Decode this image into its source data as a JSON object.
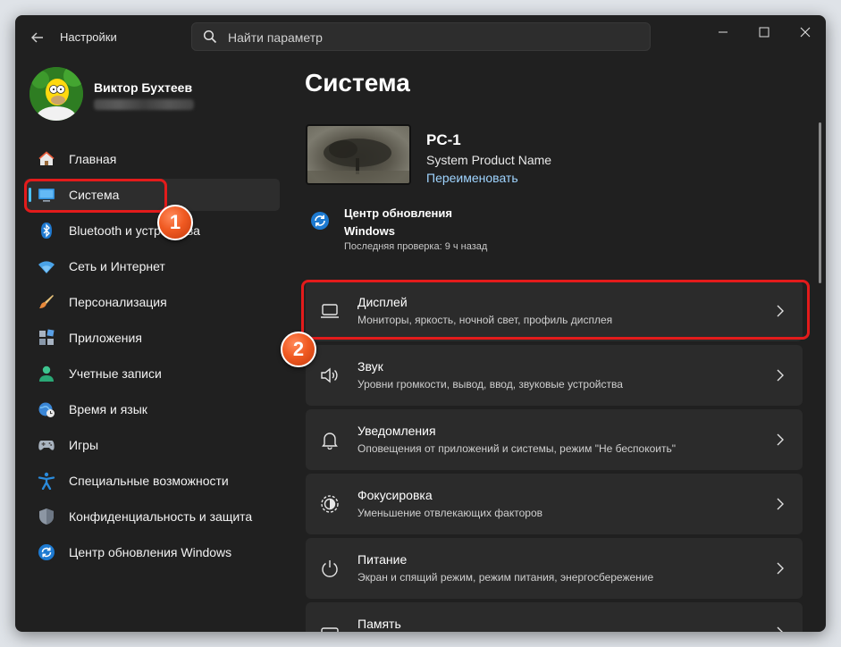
{
  "titlebar": {
    "app_title": "Настройки",
    "search_placeholder": "Найти параметр"
  },
  "profile": {
    "name": "Виктор Бухтеев"
  },
  "sidebar": {
    "items": [
      {
        "label": "Главная",
        "icon": "home-icon"
      },
      {
        "label": "Система",
        "icon": "monitor-icon",
        "active": true
      },
      {
        "label": "Bluetooth и устройства",
        "icon": "bluetooth-icon"
      },
      {
        "label": "Сеть и Интернет",
        "icon": "wifi-icon"
      },
      {
        "label": "Персонализация",
        "icon": "brush-icon"
      },
      {
        "label": "Приложения",
        "icon": "apps-icon"
      },
      {
        "label": "Учетные записи",
        "icon": "person-icon"
      },
      {
        "label": "Время и язык",
        "icon": "globe-clock-icon"
      },
      {
        "label": "Игры",
        "icon": "gamepad-icon"
      },
      {
        "label": "Специальные возможности",
        "icon": "accessibility-icon"
      },
      {
        "label": "Конфиденциальность и защита",
        "icon": "shield-icon"
      },
      {
        "label": "Центр обновления Windows",
        "icon": "update-icon"
      }
    ]
  },
  "main": {
    "title": "Система",
    "device": {
      "name": "PC-1",
      "model": "System Product Name",
      "rename_link": "Переименовать"
    },
    "windows_update": {
      "title": "Центр обновления Windows",
      "status": "Последняя проверка: 9 ч назад"
    },
    "cards": [
      {
        "title": "Дисплей",
        "subtitle": "Мониторы, яркость, ночной свет, профиль дисплея",
        "icon": "display-icon"
      },
      {
        "title": "Звук",
        "subtitle": "Уровни громкости, вывод, ввод, звуковые устройства",
        "icon": "speaker-icon"
      },
      {
        "title": "Уведомления",
        "subtitle": "Оповещения от приложений и системы, режим \"Не беспокоить\"",
        "icon": "bell-icon"
      },
      {
        "title": "Фокусировка",
        "subtitle": "Уменьшение отвлекающих факторов",
        "icon": "focus-icon"
      },
      {
        "title": "Питание",
        "subtitle": "Экран и спящий режим, режим питания, энергосбережение",
        "icon": "power-icon"
      },
      {
        "title": "Память",
        "subtitle": "",
        "icon": "storage-icon"
      }
    ]
  },
  "annotations": {
    "badge_1": "1",
    "badge_2": "2",
    "highlight_color": "#e31b1b",
    "badge_color": "#f05a22"
  },
  "colors": {
    "accent": "#4cc2ff",
    "window_bg": "#202020",
    "card_bg": "#2b2b2b"
  }
}
